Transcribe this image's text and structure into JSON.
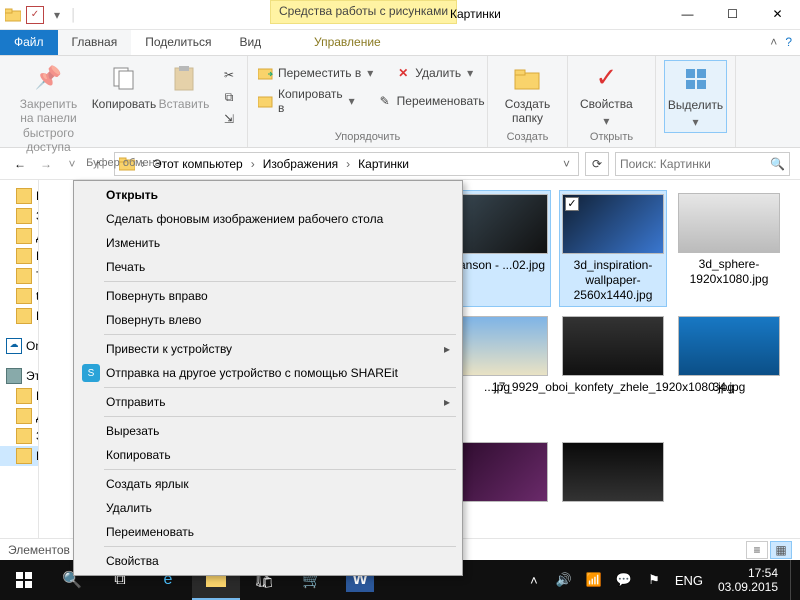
{
  "title": "Картинки",
  "contextual_tab": "Средства работы с рисунками",
  "ribbon_tabs": {
    "file": "Файл",
    "home": "Главная",
    "share": "Поделиться",
    "view": "Вид",
    "manage": "Управление"
  },
  "ribbon": {
    "pin": "Закрепить на панели быстрого доступа",
    "copy": "Копировать",
    "paste": "Вставить",
    "clipboard": "Буфер обмена",
    "moveTo": "Переместить в",
    "copyTo": "Копировать в",
    "delete": "Удалить",
    "rename": "Переименовать",
    "organize": "Упорядочить",
    "newFolder": "Создать папку",
    "new": "Создать",
    "properties": "Свойства",
    "open": "Открыть",
    "select": "Выделить"
  },
  "breadcrumbs": [
    "Этот компьютер",
    "Изображения",
    "Картинки"
  ],
  "search_placeholder": "Поиск: Картинки",
  "sidebar": {
    "items": [
      {
        "label": "Ра"
      },
      {
        "label": "За"
      },
      {
        "label": "Дс"
      },
      {
        "label": "Из"
      },
      {
        "label": "Th"
      },
      {
        "label": "to"
      },
      {
        "label": "Вь"
      }
    ],
    "onedrive": "OneDrive",
    "thispc": "Этот",
    "tpc": [
      {
        "label": "Вь"
      },
      {
        "label": "Дс"
      },
      {
        "label": "За"
      },
      {
        "label": "Из",
        "sel": true
      }
    ]
  },
  "files": [
    {
      "name": "...anson - ...02.jpg",
      "sel": true,
      "chk": false,
      "bg": "linear-gradient(135deg,#3a4a55,#111)"
    },
    {
      "name": "3d_inspiration-wallpaper-2560x1440.jpg",
      "sel": true,
      "chk": true,
      "bg": "linear-gradient(135deg,#102035,#3a77d0)"
    },
    {
      "name": "3d_sphere-1920x1080.jpg",
      "sel": false,
      "bg": "linear-gradient(#e6e6e6,#bbb)"
    },
    {
      "name": "...jpg",
      "sel": false,
      "bg": "linear-gradient(#7fb4e6,#e9e2c4)"
    },
    {
      "name": "17_9929_oboi_konfety_zhele_1920x1080.jpg",
      "sel": false,
      "bg": "linear-gradient(#333,#111)"
    },
    {
      "name": "34.jpg",
      "sel": false,
      "bg": "linear-gradient(#1878c4,#0b4f87)"
    },
    {
      "name": "",
      "sel": false,
      "bg": "linear-gradient(135deg,#2a0a2a,#6a2a6a)"
    },
    {
      "name": "",
      "sel": false,
      "bg": "linear-gradient(#0a0a0a,#333)"
    }
  ],
  "context_menu": [
    {
      "label": "Открыть",
      "bold": true
    },
    {
      "label": "Сделать фоновым изображением рабочего стола"
    },
    {
      "label": "Изменить"
    },
    {
      "label": "Печать"
    },
    {
      "sep": true
    },
    {
      "label": "Повернуть вправо"
    },
    {
      "label": "Повернуть влево"
    },
    {
      "sep": true
    },
    {
      "label": "Привести к устройству",
      "sub": true
    },
    {
      "label": "Отправка на другое устройство с помощью SHAREit",
      "icon": "shareit"
    },
    {
      "sep": true
    },
    {
      "label": "Отправить",
      "sub": true
    },
    {
      "sep": true
    },
    {
      "label": "Вырезать"
    },
    {
      "label": "Копировать"
    },
    {
      "sep": true
    },
    {
      "label": "Создать ярлык"
    },
    {
      "label": "Удалить"
    },
    {
      "label": "Переименовать"
    },
    {
      "sep": true
    },
    {
      "label": "Свойства"
    }
  ],
  "status": "Элементов",
  "clock": {
    "time": "17:54",
    "date": "03.09.2015"
  },
  "lang": "ENG"
}
